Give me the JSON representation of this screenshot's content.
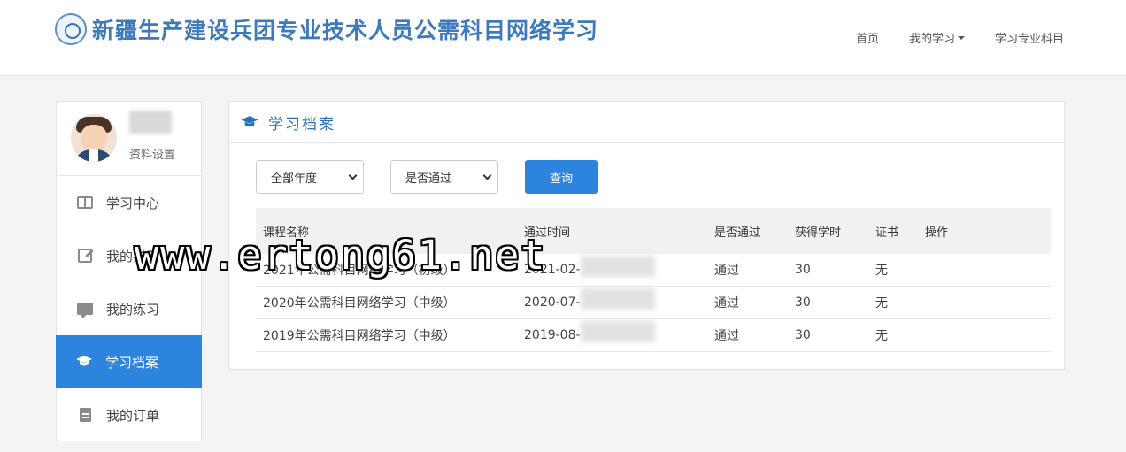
{
  "header": {
    "site_title": "新疆生产建设兵团专业技术人员公需科目网络学习",
    "nav": [
      {
        "label": "首页"
      },
      {
        "label": "我的学习"
      },
      {
        "label": "学习专业科目"
      }
    ]
  },
  "sidebar": {
    "profile_link": "资料设置",
    "items": [
      {
        "label": "学习中心",
        "icon": "book-icon"
      },
      {
        "label": "我的学习",
        "icon": "edit-icon"
      },
      {
        "label": "我的练习",
        "icon": "chat-icon"
      },
      {
        "label": "学习档案",
        "icon": "graduation-cap-icon",
        "active": true
      },
      {
        "label": "我的订单",
        "icon": "document-icon"
      }
    ]
  },
  "panel": {
    "title": "学习档案",
    "filters": {
      "year": "全部年度",
      "passed": "是否通过",
      "query_label": "查询"
    },
    "columns": [
      "课程名称",
      "通过时间",
      "是否通过",
      "获得学时",
      "证书",
      "操作"
    ],
    "rows": [
      {
        "course": "2021年公需科目网络学习（初级）",
        "time": "2021-02-",
        "passed": "通过",
        "hours": "30",
        "cert": "无"
      },
      {
        "course": "2020年公需科目网络学习（中级）",
        "time": "2020-07-",
        "passed": "通过",
        "hours": "30",
        "cert": "无"
      },
      {
        "course": "2019年公需科目网络学习（中级）",
        "time": "2019-08-",
        "passed": "通过",
        "hours": "30",
        "cert": "无"
      }
    ]
  },
  "watermark": "www.ertong61.net",
  "colors": {
    "accent": "#2d84dc",
    "title": "#3d79bd"
  }
}
